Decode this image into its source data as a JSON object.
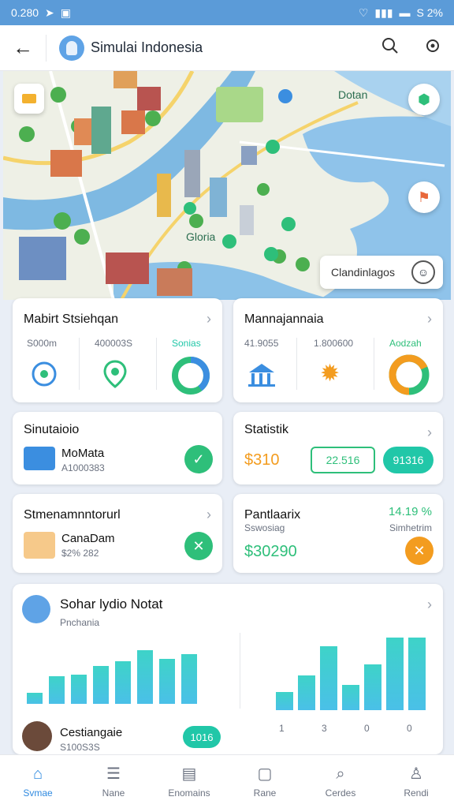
{
  "status_bar": {
    "time": "0.280",
    "right": "S 2%"
  },
  "app_bar": {
    "title": "Simulai Indonesia"
  },
  "map": {
    "labels": {
      "top_right": "Dotan",
      "center": "Gloria",
      "chip": "Clandinlagos"
    }
  },
  "card1": {
    "title": "Mabirt Stsiehqan",
    "stats": [
      "S000m",
      "400003S",
      "Sonias"
    ]
  },
  "card2": {
    "title": "Mannajannaia",
    "stats": [
      "41.9055",
      "1.800600",
      "Aodzah"
    ]
  },
  "card3": {
    "title": "Sinutaioio",
    "item_title": "MoMata",
    "item_sub": "A1000383"
  },
  "card4": {
    "title": "Statistik",
    "value_left": "$310",
    "value_mid": "22.516",
    "value_right": "91316"
  },
  "card5": {
    "title": "Stmenamnntorurl",
    "item_title": "CanaDam",
    "item_sub": "$2% 282"
  },
  "card6": {
    "title": "Pantlaarix",
    "percent": "14.19 %",
    "sub_left": "Sswosiag",
    "sub_right": "Simhetrim",
    "value": "$30290"
  },
  "card7": {
    "title": "Sohar lydio Notat",
    "subtitle": "Pnchania",
    "x_ticks": [
      "1",
      "3",
      "0",
      "0"
    ],
    "profile_name": "Cestiangaie",
    "profile_sub": "S100S3S",
    "profile_badge": "1016"
  },
  "chart_data": [
    {
      "type": "bar",
      "values": [
        12,
        30,
        32,
        41,
        46,
        58,
        49,
        54
      ],
      "ylim": [
        0,
        70
      ]
    },
    {
      "type": "bar",
      "values": [
        20,
        38,
        70,
        28,
        50,
        80,
        80
      ],
      "ylim": [
        0,
        90
      ]
    }
  ],
  "bottom_nav": [
    {
      "label": "Svmae",
      "icon": "home-icon"
    },
    {
      "label": "Nane",
      "icon": "menu-icon"
    },
    {
      "label": "Enomains",
      "icon": "layers-icon"
    },
    {
      "label": "Rane",
      "icon": "notification-icon"
    },
    {
      "label": "Cerdes",
      "icon": "search-icon"
    },
    {
      "label": "Rendi",
      "icon": "profile-icon"
    }
  ],
  "colors": {
    "accent": "#2f8ae0",
    "green": "#2ebf7a",
    "orange": "#f39c1f",
    "teal": "#21c7a8"
  }
}
